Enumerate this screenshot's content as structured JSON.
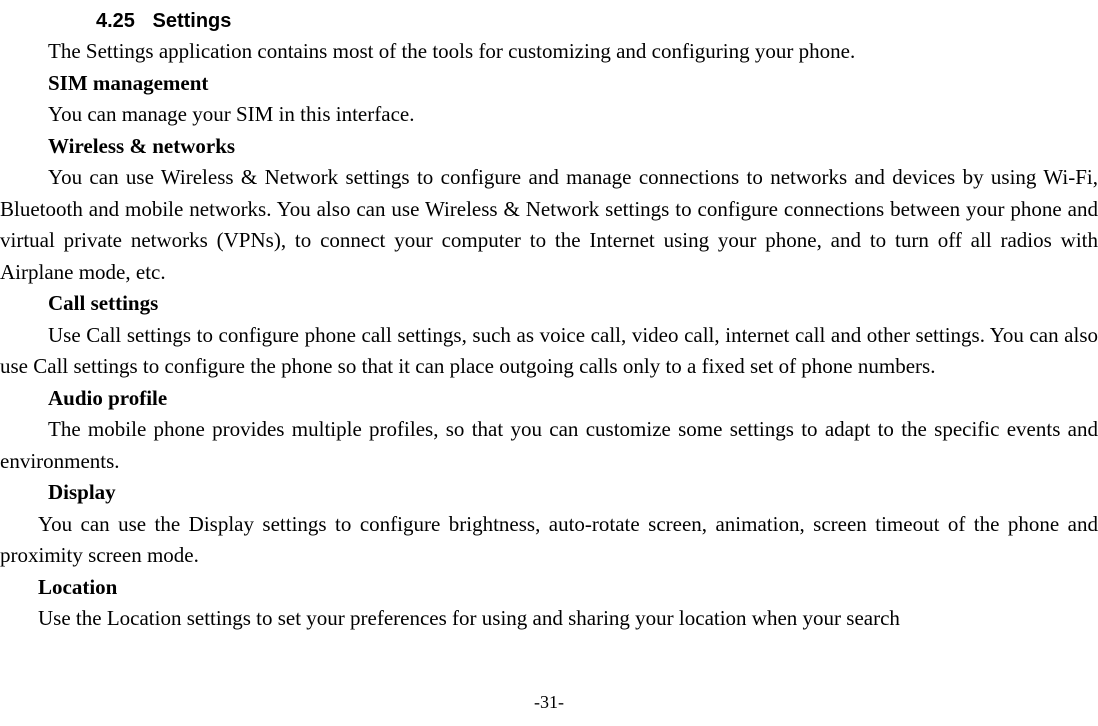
{
  "section": {
    "number": "4.25",
    "title": "Settings"
  },
  "intro": "The Settings application contains most of the tools for customizing and configuring your phone.",
  "sim": {
    "heading": "SIM management",
    "body": "You can manage your SIM in this interface."
  },
  "wireless": {
    "heading": "Wireless & networks",
    "body": "You can use Wireless & Network settings to configure and manage connections to networks and devices by using Wi-Fi, Bluetooth and mobile networks. You also can use Wireless & Network settings to configure connections between your phone and virtual private networks (VPNs), to connect your computer to the Internet using your phone, and to turn off all radios with Airplane mode, etc."
  },
  "call": {
    "heading": "Call settings",
    "body": "Use Call settings to configure phone call settings, such as voice call, video call, internet call and other settings. You can also use Call settings to configure the phone so that it can place outgoing calls only to a fixed set of phone numbers."
  },
  "audio": {
    "heading": "Audio profile",
    "body": "The mobile phone provides multiple profiles, so that you can customize some settings to adapt to the specific events and environments."
  },
  "display": {
    "heading": "Display",
    "body": "You can use the Display settings to configure brightness, auto-rotate screen, animation, screen timeout of the phone and proximity screen mode."
  },
  "location": {
    "heading": "Location",
    "body": "Use the Location settings to set your preferences for using and sharing your location when your search"
  },
  "pageNumber": "-31-"
}
